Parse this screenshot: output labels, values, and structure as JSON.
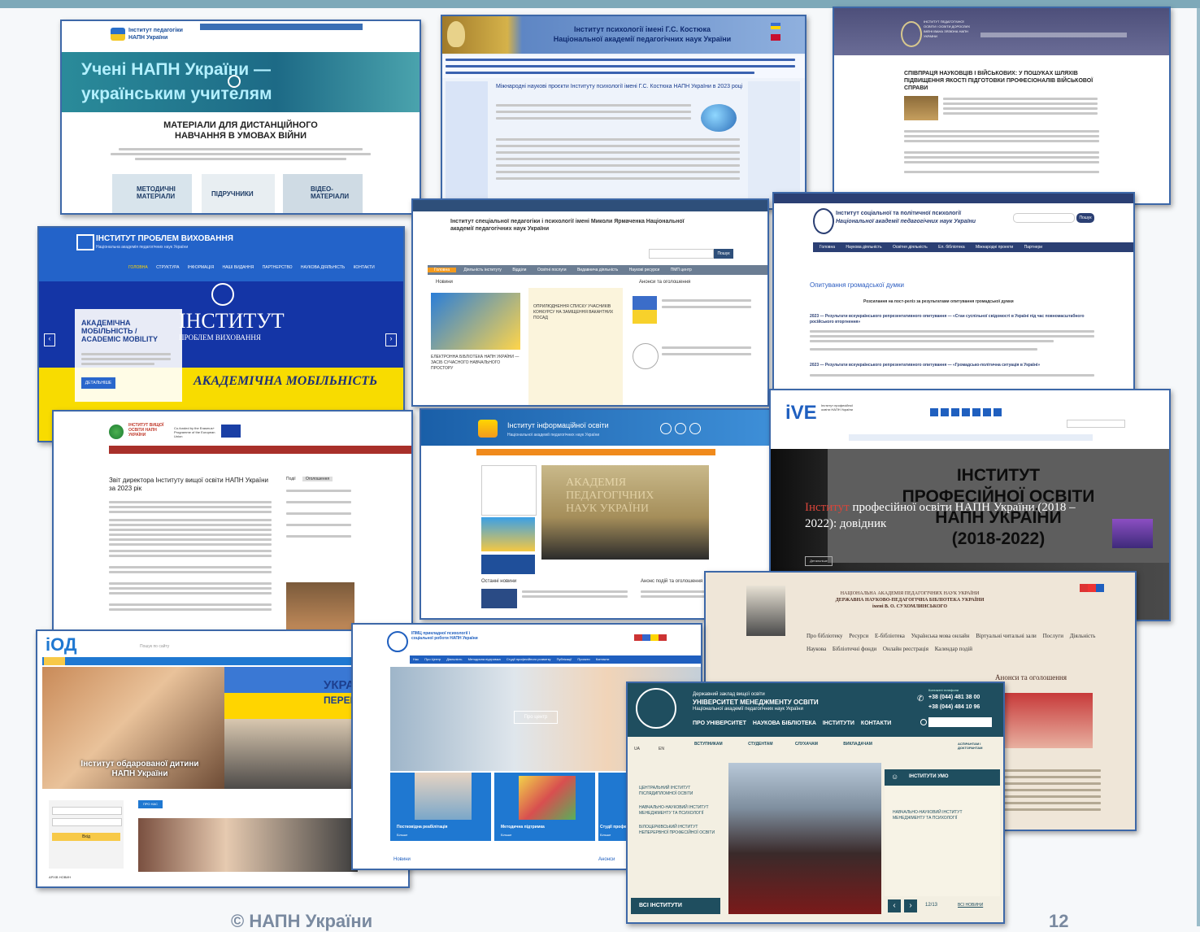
{
  "footer": {
    "copyright": "© НАПН України",
    "page_number": "12"
  },
  "screens": {
    "s1": {
      "logo_line1": "Інститут педагогіки",
      "logo_line2": "НАПН України",
      "banner_line1": "Учені НАПН України —",
      "banner_line2": "українським учителям",
      "heading_line1": "МАТЕРІАЛИ ДЛЯ ДИСТАНЦІЙНОГО",
      "heading_line2": "НАВЧАННЯ В УМОВАХ ВІЙНИ",
      "card1_line1": "МЕТОДИЧНІ",
      "card1_line2": "МАТЕРІАЛИ",
      "card2": "ПІДРУЧНИКИ",
      "card3_line1": "ВІДЕО-",
      "card3_line2": "МАТЕРІАЛИ"
    },
    "s2": {
      "header_line1": "Інститут психології імені Г.С. Костюка",
      "header_line2": "Національної академії педагогічних наук України",
      "article_title": "Міжнародні наукові проєкти Інституту психології імені Г.С. Костюка НАПН України в 2023 році"
    },
    "s3": {
      "logo_text": "ІНСТИТУТ ПЕДАГОГІЧНОЇ ОСВІТИ І ОСВІТИ ДОРОСЛИХ ІМЕНІ ІВАНА ЗЯЗЮНА НАПН УКРАЇНИ",
      "article_title": "СПІВПРАЦЯ НАУКОВЦІВ І ВІЙСЬКОВИХ: У ПОШУКАХ ШЛЯХІВ ПІДВИЩЕННЯ ЯКОСТІ ПІДГОТОВКИ ПРОФЕСІОНАЛІВ ВІЙСЬКОВОЇ СПРАВИ"
    },
    "s4": {
      "title": "ІНСТИТУТ ПРОБЛЕМ ВИХОВАННЯ",
      "subtitle": "Національна академія педагогічних наук України",
      "nav": [
        "ГОЛОВНА",
        "СТРУКТУРА",
        "ІНФОРМАЦІЯ",
        "НАШІ ВИДАННЯ",
        "ПАРТНЕРСТВО",
        "НАУКОВА ДІЯЛЬНІСТЬ",
        "КОНТАКТИ"
      ],
      "hero_line1": "ІНСТИТУТ",
      "hero_line2": "ПРОБЛЕМ ВИХОВАННЯ",
      "card_line1": "АКАДЕМІЧНА",
      "card_line2": "МОБІЛЬНІСТЬ /",
      "card_line3": "ACADEMIC MOBILITY",
      "card_button": "ДЕТАЛЬНІШЕ",
      "banner_text": "АКАДЕМІЧНА МОБІЛЬНІСТЬ"
    },
    "s5": {
      "title_line1": "Інститут спеціальної педагогіки і психології імені Миколи Ярмаченка Національної",
      "title_line2": "академії педагогічних наук України",
      "search_button": "Пошук",
      "nav": [
        "Головна",
        "Діяльність інституту",
        "Відділи",
        "Освітні послуги",
        "Видавнича діяльність",
        "Наукові ресурси",
        "ПМП центр"
      ],
      "news_heading": "Новини",
      "announce_heading": "Анонси та оголошення",
      "news_item": "ЕЛЕКТРОННА БІБЛІОТЕКА НАПН УКРАЇНИ — ЗАСІБ СУЧАСНОГО НАВЧАЛЬНОГО ПРОСТОРУ",
      "news_item2": "ОПРИЛЮДНЕННЯ СПИСКУ УЧАСНИКІВ КОНКУРСУ НА ЗАМІЩЕННЯ ВАКАНТНИХ ПОСАД"
    },
    "s6": {
      "title_line1": "Інститут соціальної та політичної психології",
      "title_line2": "Національної академії педагогічних наук України",
      "search_button": "Пошук",
      "nav": [
        "Головна",
        "Наукова діяльність",
        "Освітня діяльність",
        "Ел. бібліотека",
        "Міжнародні проекти",
        "Партнери"
      ],
      "section_title": "Опитування громадської думки",
      "line1": "Розсилання на пост-реліз за результатами опитування громадської думки",
      "item1": "2023 — Результати всеукраїнського репрезентативного опитування — «Стан суспільної свідомості в Україні під час повномасштабного російського вторгнення»",
      "item2": "2023 — Результати всеукраїнського репрезентативного опитування — «Громадсько-політична ситуація в Україні»"
    },
    "s7": {
      "logo_text": "ІНСТИТУТ ВИЩОЇ ОСВІТИ НАПН УКРАЇНИ",
      "eu_text": "Co-funded by the Erasmus+ Programme of the European Union",
      "article_title": "Звіт директора Інституту вищої освіти НАПН України за 2023 рік",
      "sidebar_tab1": "Події",
      "sidebar_tab2": "Оголошення"
    },
    "s8": {
      "title": "Інститут інформаційної освіти",
      "subtitle": "Національної академії педагогічних наук України",
      "photo_caption": "АКАДЕМІЯ ПЕДАГОГІЧНИХ НАУК УКРАЇНИ",
      "news_heading": "Останні новини",
      "announce_heading": "Анонс подій та оголошення"
    },
    "s9": {
      "logo": "iVE",
      "logo_caption": "Інститут професійної освіти НАПН України",
      "hero_line1": "ІНСТИТУТ",
      "hero_line2": "ПРОФЕСІЙНОЇ ОСВІТИ",
      "hero_line3": "НАПН УКРАЇНИ",
      "hero_line4": "(2018-2022)",
      "overlay_prefix": "Інститут",
      "overlay_rest": " професійної освіти НАПН України (2018 –",
      "overlay_line2": "2022): довідник",
      "button": "Детальніше"
    },
    "s10": {
      "header_line1": "НАЦІОНАЛЬНА АКАДЕМІЯ ПЕДАГОГІЧНИХ НАУК УКРАЇНИ",
      "header_line2": "ДЕРЖАВНА НАУКОВО-ПЕДАГОГІЧНА БІБЛІОТЕКА УКРАЇНИ",
      "header_line3": "імені В. О. СУХОМЛИНСЬКОГО",
      "nav1": [
        "Про бібліотеку",
        "Ресурси",
        "Е-бібліотека",
        "Українська мова онлайн",
        "Віртуальні читальні зали",
        "Послуги",
        "Діяльність"
      ],
      "nav2": [
        "Наукова",
        "Бібліотечні фонди",
        "Онлайн реєстрація",
        "Календар подій"
      ],
      "sidebar_title": "Анонси та оголошення"
    },
    "s11": {
      "logo": "іОД",
      "search_placeholder": "Пошук по сайту",
      "banner_line1": "УКРАЇНА",
      "banner_line2": "ПЕРЕМОЖЕ",
      "caption_line1": "Інститут обдарованої дитини",
      "caption_line2": "НАПН України",
      "tab": "ПРО НАС",
      "login_button": "Вхід",
      "news_link": "АРХІВ НОВИН"
    },
    "s12": {
      "logo_line1": "ІПМЦ прикладної психології і",
      "logo_line2": "соціальної роботи НАПН України",
      "nav": [
        "Нас",
        "Про Центр",
        "Діяльність",
        "Методична підтримка",
        "Студії професійного розвитку",
        "Публікації",
        "Проєкти",
        "Контакти"
      ],
      "hero_button": "Про центр",
      "card1": "Постковідна реабілітація",
      "card2": "Методична підтримка",
      "card3": "Студії профес",
      "more": "Більше",
      "footer_news": "Новини",
      "footer_announce": "Анонси"
    },
    "s13": {
      "header_line1": "Державний заклад вищої освіти",
      "header_line2": "УНІВЕРСИТЕТ МЕНЕДЖМЕНТУ ОСВІТИ",
      "header_line3": "Національної академії педагогічних наук України",
      "phone_label": "Контактні телефони",
      "phone1": "+38 (044) 481 38 00",
      "phone2": "+38 (044) 484 10 96",
      "nav": [
        "ПРО УНІВЕРСИТЕТ",
        "НАУКОВА БІБЛІОТЕКА",
        "ІНСТИТУТИ",
        "КОНТАКТИ"
      ],
      "lang_ua": "UA",
      "lang_en": "EN",
      "audience": [
        "ВСТУПНИКАМ",
        "СТУДЕНТАМ",
        "СЛУХАЧАМ",
        "ВИКЛАДАЧАМ",
        "АСПІРАНТАМ І ДОКТОРАНТАМ"
      ],
      "institutes": [
        "ЦЕНТРАЛЬНИЙ ІНСТИТУТ ПІСЛЯДИПЛОМНОЇ ОСВІТИ",
        "НАВЧАЛЬНО-НАУКОВИЙ ІНСТИТУТ МЕНЕДЖМЕНТУ ТА ПСИХОЛОГІЇ",
        "БІЛОЦЕРКІВСЬКИЙ ІНСТИТУТ НЕПЕРЕРВНОЇ ПРОФЕСІЙНОЇ ОСВІТИ"
      ],
      "panel_title": "ІНСТИТУТИ УМО",
      "panel_item": "НАВЧАЛЬНО-НАУКОВИЙ ІНСТИТУТ МЕНЕДЖМЕНТУ ТА ПСИХОЛОГІЇ",
      "all_button": "ВСІ ІНСТИТУТИ",
      "counter": "12/13",
      "all_news": "ВСІ НОВИНИ"
    }
  },
  "colors": {
    "accent_blue": "#1f5fbf",
    "ukraine_yellow": "#ffd500",
    "teal": "#1a6f86",
    "napn_orange": "#f39a1e"
  }
}
